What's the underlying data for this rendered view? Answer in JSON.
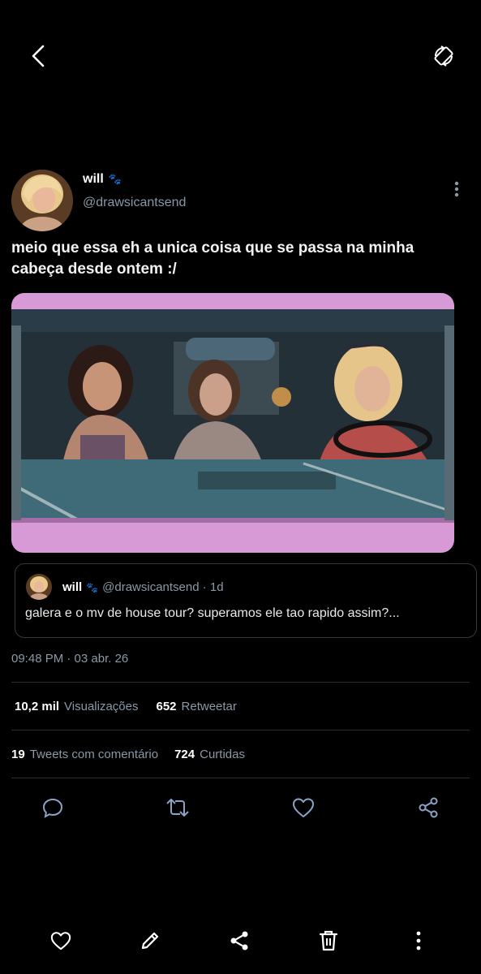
{
  "author": {
    "name": "will",
    "name_emoji": "🐾",
    "handle": "@drawsicantsend"
  },
  "tweet": {
    "text": "meio que essa eh a unica coisa que se passa na minha cabeça desde ontem :/",
    "timestamp": "09:48 PM · 03 abr. 26"
  },
  "quote": {
    "name": "will",
    "name_emoji": "🐾",
    "meta": "@drawsicantsend · 1d",
    "text": "galera e o mv de house tour? superamos ele tao rapido assim?..."
  },
  "stats": {
    "views_count": "10,2 mil",
    "views_label": "Visualizações",
    "retweets_count": "652",
    "retweets_label": "Retweetar",
    "comments_count": "19",
    "comments_label": "Tweets com comentário",
    "likes_count": "724",
    "likes_label": "Curtidas"
  },
  "icons": {
    "top": [
      "back-icon",
      "rotate-icon"
    ],
    "tweet_actions": [
      "reply-icon",
      "retweet-icon",
      "like-icon",
      "share-icon"
    ],
    "system_bar": [
      "heart-icon",
      "edit-icon",
      "share-icon",
      "delete-icon",
      "more-vertical-icon"
    ]
  },
  "colors": {
    "background": "#000000",
    "secondary_text": "#8b98a5",
    "icon_blue": "#8aa3c7",
    "car_pink": "#d79ad6"
  }
}
